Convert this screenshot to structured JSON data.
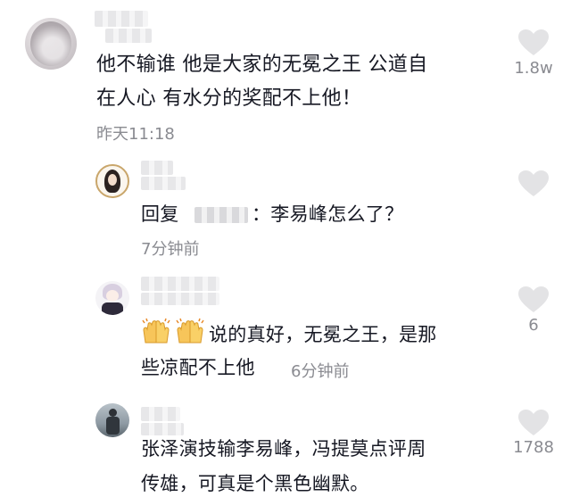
{
  "comments": [
    {
      "text_line1": "他不输谁 他是大家的无冕之王 公道自",
      "text_line2": "在人心 有水分的奖配不上他！",
      "time": "昨天11:18",
      "likes": "1.8w"
    },
    {
      "reply_prefix": "回复",
      "reply_text": "：李易峰怎么了？",
      "time": "7分钟前"
    },
    {
      "text_line1": "说的真好，无冕之王，是那",
      "text_line2": "些凉配不上他",
      "time": "6分钟前",
      "likes": "6"
    },
    {
      "text_line1": "张泽演技输李易峰，冯提莫点评周",
      "text_line2": "传雄，可真是个黑色幽默。",
      "likes": "1788"
    }
  ],
  "colors": {
    "text": "#161823",
    "meta": "#8a8b91",
    "heart": "#e3e3e5"
  },
  "icons": [
    "heart-icon",
    "clapping-hands-emoji"
  ]
}
